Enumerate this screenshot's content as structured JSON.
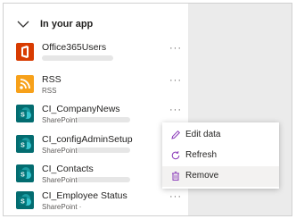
{
  "section": {
    "title": "In your app"
  },
  "data_sources": [
    {
      "name": "Office365Users",
      "subtitle": "",
      "icon": "office-icon",
      "color": "#d83b01"
    },
    {
      "name": "RSS",
      "subtitle": "RSS",
      "icon": "rss-icon",
      "color": "#f7a11a"
    },
    {
      "name": "CI_CompanyNews",
      "subtitle": "SharePoint ·",
      "icon": "sharepoint-icon",
      "color": "#036c70"
    },
    {
      "name": "CI_configAdminSetup",
      "subtitle": "SharePoint ·",
      "icon": "sharepoint-icon",
      "color": "#036c70"
    },
    {
      "name": "CI_Contacts",
      "subtitle": "SharePoint ·",
      "icon": "sharepoint-icon",
      "color": "#036c70"
    },
    {
      "name": "CI_Employee Status",
      "subtitle": "SharePoint ·",
      "icon": "sharepoint-icon",
      "color": "#036c70"
    }
  ],
  "more_label": "···",
  "context_menu": {
    "items": [
      {
        "label": "Edit data",
        "icon": "pencil-icon"
      },
      {
        "label": "Refresh",
        "icon": "refresh-icon"
      },
      {
        "label": "Remove",
        "icon": "trash-icon"
      }
    ]
  }
}
